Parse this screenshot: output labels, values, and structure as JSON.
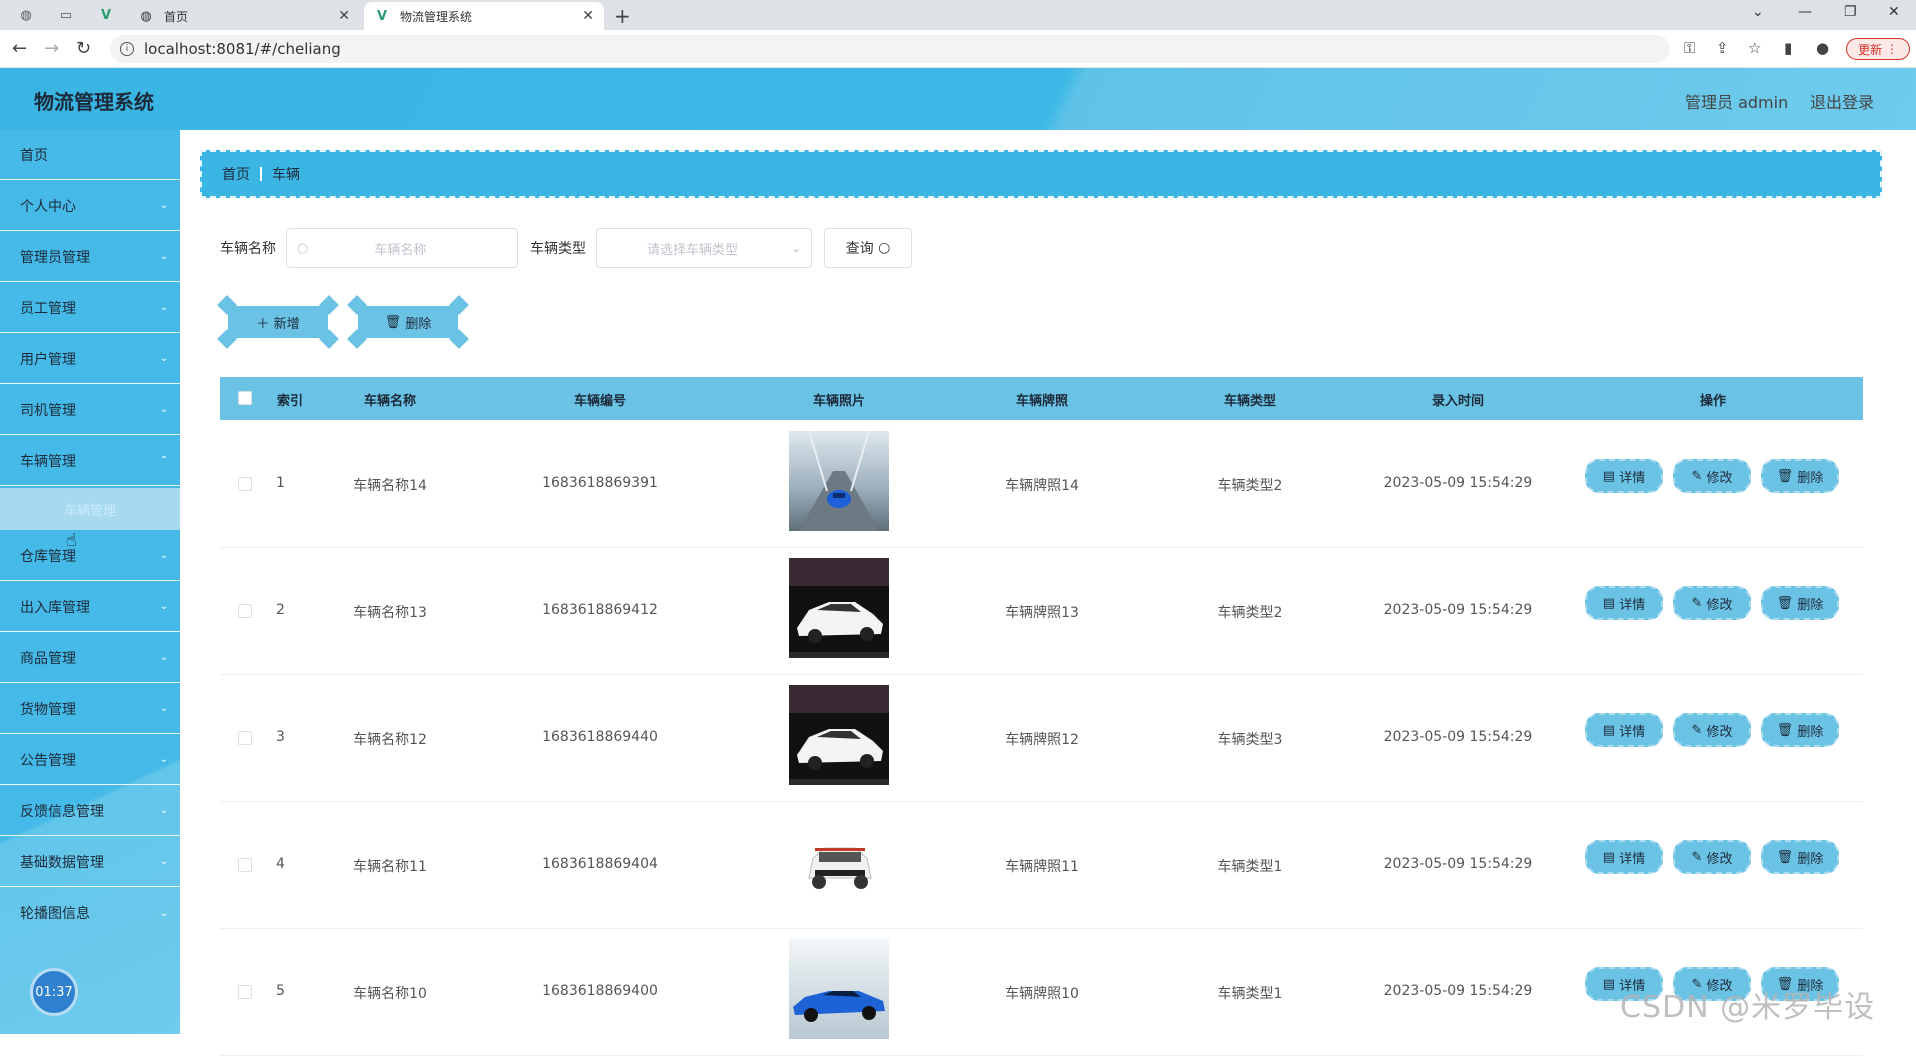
{
  "browser": {
    "tabs": [
      {
        "label": "首页",
        "active": false
      },
      {
        "label": "物流管理系统",
        "active": true
      }
    ],
    "new_tab": "+",
    "url": "localhost:8081/#/cheliang",
    "update_label": "更新"
  },
  "header": {
    "app_title": "物流管理系统",
    "user_label": "管理员 admin",
    "logout_label": "退出登录"
  },
  "sidebar": {
    "items": [
      {
        "label": "首页"
      },
      {
        "label": "个人中心"
      },
      {
        "label": "管理员管理"
      },
      {
        "label": "员工管理"
      },
      {
        "label": "用户管理"
      },
      {
        "label": "司机管理"
      },
      {
        "label": "车辆管理"
      },
      {
        "label": "仓库管理"
      },
      {
        "label": "出入库管理"
      },
      {
        "label": "商品管理"
      },
      {
        "label": "货物管理"
      },
      {
        "label": "公告管理"
      },
      {
        "label": "反馈信息管理"
      },
      {
        "label": "基础数据管理"
      },
      {
        "label": "轮播图信息"
      }
    ],
    "submenu_label": "车辆管理",
    "clock": "01:37"
  },
  "breadcrumb": {
    "home": "首页",
    "current": "车辆"
  },
  "search": {
    "name_label": "车辆名称",
    "name_placeholder": "车辆名称",
    "type_label": "车辆类型",
    "type_placeholder": "请选择车辆类型",
    "query_label": "查询"
  },
  "actions": {
    "add_label": "新增",
    "delete_label": "删除"
  },
  "table": {
    "headers": [
      "索引",
      "车辆名称",
      "车辆编号",
      "车辆照片",
      "车辆牌照",
      "车辆类型",
      "录入时间",
      "操作"
    ],
    "rows": [
      {
        "index": "1",
        "name": "车辆名称14",
        "number": "1683618869391",
        "plate": "车辆牌照14",
        "type": "车辆类型2",
        "time": "2023-05-09 15:54:29",
        "photo": "blue-sports-car-on-bridge"
      },
      {
        "index": "2",
        "name": "车辆名称13",
        "number": "1683618869412",
        "plate": "车辆牌照13",
        "type": "车辆类型2",
        "time": "2023-05-09 15:54:29",
        "photo": "white-hatchback-dark-studio"
      },
      {
        "index": "3",
        "name": "车辆名称12",
        "number": "1683618869440",
        "plate": "车辆牌照12",
        "type": "车辆类型3",
        "time": "2023-05-09 15:54:29",
        "photo": "white-hatchback-dark-studio"
      },
      {
        "index": "4",
        "name": "车辆名称11",
        "number": "1683618869404",
        "plate": "车辆牌照11",
        "type": "车辆类型1",
        "time": "2023-05-09 15:54:29",
        "photo": "white-suv-white-background"
      },
      {
        "index": "5",
        "name": "车辆名称10",
        "number": "1683618869400",
        "plate": "车辆牌照10",
        "type": "车辆类型1",
        "time": "2023-05-09 15:54:29",
        "photo": "blue-sports-car-studio"
      }
    ],
    "op_labels": {
      "detail": "详情",
      "edit": "修改",
      "delete": "删除"
    }
  },
  "watermark": "CSDN @米罗毕设",
  "colors": {
    "primary": "#3bb5e3",
    "button": "#6ac2e4",
    "header_text": "#1d2a3a"
  }
}
